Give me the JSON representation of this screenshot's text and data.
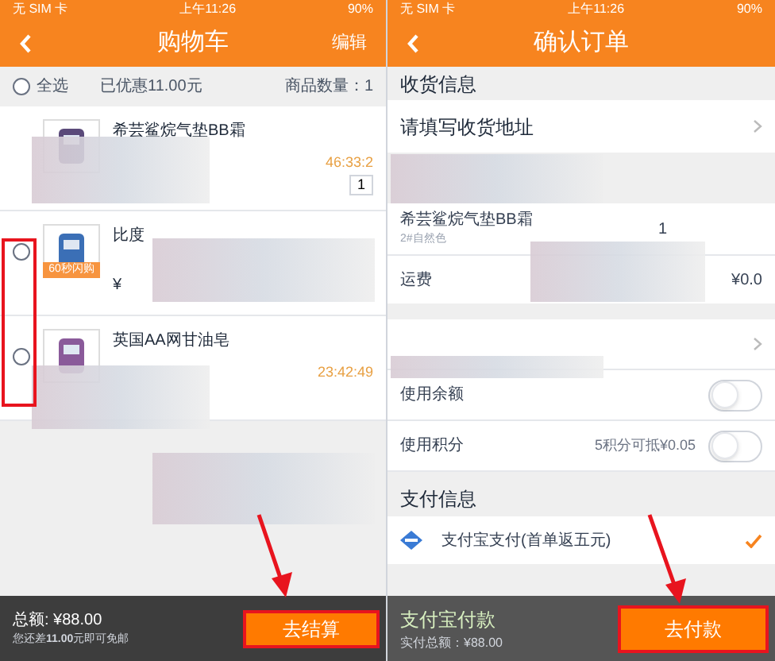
{
  "cart_screen": {
    "status_bar": {
      "carrier": "无 SIM 卡",
      "time": "上午11:26",
      "battery": "90%"
    },
    "title": "购物车",
    "edit": "编辑",
    "summary": {
      "select_all": "全选",
      "select_all_checked": false,
      "discount": "已优惠11.00元",
      "count": "商品数量：1"
    },
    "items": [
      {
        "title": "希芸鲨烷气垫BB霜",
        "timer": "46:33:2",
        "qty": "1"
      },
      {
        "title": "比度",
        "price": "¥",
        "checkbox": false,
        "badge": "60秒闪购"
      },
      {
        "title": "英国AA网甘油皂",
        "timer": "23:42:49",
        "checkbox": false
      }
    ],
    "footer": {
      "total": "总额: ¥88.00",
      "note": "您还差$^{}$**11.00**元即可免邮",
      "button": "去结算"
    }
  },
  "order_screen": {
    "status_bar": {
      "carrier": "无 SIM 卡",
      "time": "上午11:26",
      "battery": "90%"
    },
    "title": "确认订单",
    "shipping_header": "收货信息",
    "address": "请填写收货地址",
    "product": {
      "title": "希芸鲨烷气垫BB霜",
      "variant": "2#自然色",
      "qty": "1"
    },
    "shipping_fee": {
      "label": "运费",
      "value": "¥0.0"
    },
    "options": [
      {
        "kind": "link"
      },
      {
        "kind": "toggle",
        "label": "使用余额",
        "on": false
      },
      {
        "kind": "toggle",
        "label": "使用积分",
        "note": "5积分可抵¥0.05",
        "on": false
      }
    ],
    "payment_header": "支付信息",
    "payment": {
      "label": "支付宝支付(首单返五元)",
      "selected": true
    },
    "footer": {
      "method": "支付宝付款",
      "total": "实付总额：¥88.00",
      "button": "去付款"
    }
  }
}
